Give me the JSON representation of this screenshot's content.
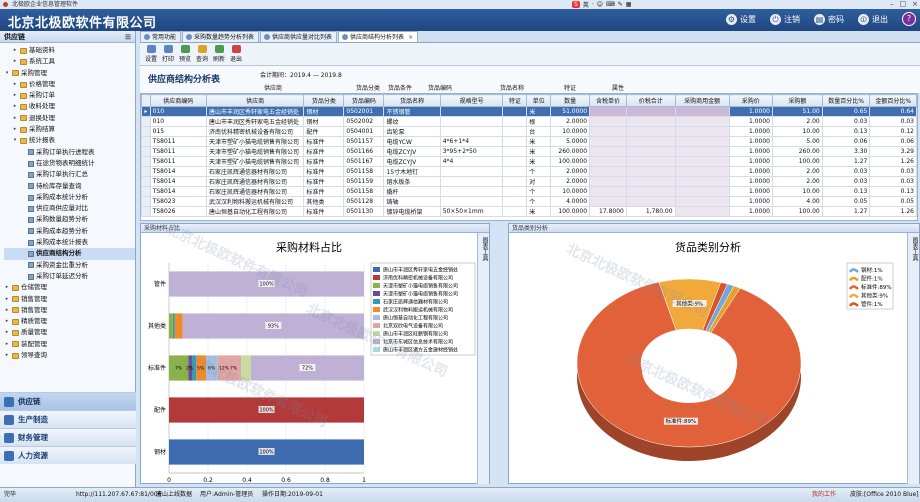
{
  "window": {
    "title": "北极欧企业信息管理软件"
  },
  "ime": {
    "items": [
      "S",
      "英",
      "·",
      "☺",
      "⌨",
      "✎",
      "▦"
    ]
  },
  "header": {
    "company": "北京北极欧软件有限公司",
    "buttons": [
      {
        "label": "设置",
        "icon": "gear-icon"
      },
      {
        "label": "注销",
        "icon": "logout-icon"
      },
      {
        "label": "密码",
        "icon": "key-icon"
      },
      {
        "label": "退出",
        "icon": "power-icon"
      }
    ],
    "help_icon": "?"
  },
  "sidebar": {
    "title": "供应链",
    "pin": "⊞",
    "tree": [
      {
        "label": "基础资料",
        "level": 2,
        "type": "folder",
        "exp": "▸"
      },
      {
        "label": "系统工具",
        "level": 2,
        "type": "folder",
        "exp": "▸"
      },
      {
        "label": "采购管理",
        "level": 1,
        "type": "folder",
        "exp": "▾"
      },
      {
        "label": "价格管理",
        "level": 2,
        "type": "folder",
        "exp": "▸"
      },
      {
        "label": "采购订单",
        "level": 2,
        "type": "folder",
        "exp": "▸"
      },
      {
        "label": "收料处理",
        "level": 2,
        "type": "folder",
        "exp": "▸"
      },
      {
        "label": "退换处理",
        "level": 2,
        "type": "folder",
        "exp": "▸"
      },
      {
        "label": "采购结算",
        "level": 2,
        "type": "folder",
        "exp": "▸"
      },
      {
        "label": "统计报表",
        "level": 2,
        "type": "folder",
        "exp": "▾"
      },
      {
        "label": "采购订单执行进程表",
        "level": 3,
        "type": "leaf"
      },
      {
        "label": "在途货物表明细统计",
        "level": 3,
        "type": "leaf"
      },
      {
        "label": "采购订单执行汇总",
        "level": 3,
        "type": "leaf"
      },
      {
        "label": "待检库存量查询",
        "level": 3,
        "type": "leaf"
      },
      {
        "label": "采购成本统计分析",
        "level": 3,
        "type": "leaf"
      },
      {
        "label": "供应商供应量对比",
        "level": 3,
        "type": "leaf"
      },
      {
        "label": "采购数量趋势分析",
        "level": 3,
        "type": "leaf"
      },
      {
        "label": "采购成本趋势分析",
        "level": 3,
        "type": "leaf"
      },
      {
        "label": "采购成本统计报表",
        "level": 3,
        "type": "leaf"
      },
      {
        "label": "供应商结构分析",
        "level": 3,
        "type": "leaf",
        "selected": true
      },
      {
        "label": "采购资金比重分析",
        "level": 3,
        "type": "leaf"
      },
      {
        "label": "采购订单延迟分析",
        "level": 3,
        "type": "leaf"
      },
      {
        "label": "仓储管理",
        "level": 1,
        "type": "folder",
        "exp": "▸"
      },
      {
        "label": "销售管理",
        "level": 1,
        "type": "folder",
        "exp": "▸"
      },
      {
        "label": "销售管理",
        "level": 1,
        "type": "folder",
        "exp": "▸"
      },
      {
        "label": "精质管理",
        "level": 1,
        "type": "folder",
        "exp": "▸"
      },
      {
        "label": "质量管理",
        "level": 1,
        "type": "folder",
        "exp": "▸"
      },
      {
        "label": "装配管理",
        "level": 1,
        "type": "folder",
        "exp": "▸"
      },
      {
        "label": "领导查询",
        "level": 1,
        "type": "folder",
        "exp": "▸"
      }
    ],
    "modules": [
      "供应链",
      "生产制造",
      "财务管理",
      "人力资源"
    ]
  },
  "tabs": [
    {
      "label": "常用功能"
    },
    {
      "label": "采购数量趋势分析列表"
    },
    {
      "label": "供应商供应量对比列表"
    },
    {
      "label": "供应商结构分析列表",
      "active": true,
      "close": "×"
    }
  ],
  "toolbar": [
    "设置",
    "打印",
    "预览",
    "查询",
    "刷新",
    "退出"
  ],
  "report": {
    "title": "供应商结构分析表",
    "period_label": "会计期间：2019.4 — 2019.8",
    "filter_labels": [
      "供应商",
      "货品分类",
      "货品条件",
      "货品编码",
      "货品名称",
      "特证",
      "属性"
    ]
  },
  "grid": {
    "columns": [
      "供应商编码",
      "供应商",
      "货品分类",
      "货品编码",
      "货品名称",
      "规格型号",
      "特证",
      "单位",
      "数量",
      "含税单价",
      "价税合计",
      "采购商用金额",
      "采购价",
      "采购额",
      "数量百分比%",
      "金额百分比%"
    ],
    "rows": [
      [
        "010",
        "唐山市丰润区秀轩家电五金经销处",
        "钢材",
        "0502001",
        "不锈钢管",
        "",
        "",
        "米",
        "51.0000",
        "",
        "",
        "",
        "1.0000",
        "51.00",
        "0.65",
        "0.64"
      ],
      [
        "010",
        "唐山市丰润区秀轩家电五金经销处",
        "钢材",
        "0502002",
        "螺纹",
        "",
        "",
        "根",
        "2.0000",
        "",
        "",
        "",
        "1.0000",
        "2.00",
        "0.03",
        "0.03"
      ],
      [
        "015",
        "济南优科精密机械设备有限公司",
        "配件",
        "0504001",
        "齿轮泵",
        "",
        "",
        "台",
        "10.0000",
        "",
        "",
        "",
        "1.0000",
        "10.00",
        "0.13",
        "0.12"
      ],
      [
        "TS8011",
        "天津市塑矿小猫电缆销售有限公司",
        "标准件",
        "0501157",
        "电缆YCW",
        "4*6+1*4",
        "",
        "米",
        "5.0000",
        "",
        "",
        "",
        "1.0000",
        "5.00",
        "0.06",
        "0.06"
      ],
      [
        "TS8011",
        "天津市塑矿小猫电缆销售有限公司",
        "标准件",
        "0501166",
        "电缆ZCYJV",
        "3*95+2*50",
        "",
        "米",
        "260.0000",
        "",
        "",
        "",
        "1.0000",
        "260.00",
        "3.30",
        "3.29"
      ],
      [
        "TS8011",
        "天津市塑矿小猫电缆销售有限公司",
        "标准件",
        "0501167",
        "电缆ZCYJV",
        "4*4",
        "",
        "米",
        "100.0000",
        "",
        "",
        "",
        "1.0000",
        "100.00",
        "1.27",
        "1.26"
      ],
      [
        "TS8014",
        "石家庄凯辉通信器材有限公司",
        "标准件",
        "0501158",
        "15寸木地钉",
        "",
        "",
        "个",
        "2.0000",
        "",
        "",
        "",
        "1.0000",
        "2.00",
        "0.03",
        "0.03"
      ],
      [
        "TS8014",
        "石家庄凯辉通信器材有限公司",
        "标准件",
        "0501159",
        "熔水板条",
        "",
        "",
        "对",
        "2.0000",
        "",
        "",
        "",
        "1.0000",
        "2.00",
        "0.03",
        "0.03"
      ],
      [
        "TS8014",
        "石家庄凯辉通信器材有限公司",
        "标准件",
        "0501158",
        "撬杆",
        "",
        "",
        "个",
        "10.0000",
        "",
        "",
        "",
        "1.0000",
        "10.00",
        "0.13",
        "0.13"
      ],
      [
        "TS8023",
        "武汉汉利物料搬运机械有限公司",
        "其他类",
        "0501128",
        "铸轴",
        "",
        "",
        "个",
        "4.0000",
        "",
        "",
        "",
        "1.0000",
        "4.00",
        "0.05",
        "0.05"
      ],
      [
        "TS8026",
        "唐山恒基自动化工程有限公司",
        "标准件",
        "0501130",
        "镀锌电缆桥架",
        "50×50×1mm",
        "",
        "米",
        "100.0000",
        "17.8000",
        "1,780.00",
        "",
        "1.0000",
        "100.00",
        "1.27",
        "1.26"
      ]
    ]
  },
  "left_panel": {
    "header": "采购材料占比",
    "title": "采购材料占比",
    "side_label": "图表工具",
    "xticks": [
      "0",
      "0.2",
      "0.4",
      "0.6",
      "0.8",
      "1"
    ]
  },
  "right_panel": {
    "header": "货品类别分析",
    "title": "货品类别分析",
    "side_label": "图表工具",
    "legend": [
      "钢材:1%",
      "配件:1%",
      "标准件:89%",
      "其他类:9%",
      "管件:1%"
    ]
  },
  "chart_data": [
    {
      "type": "bar",
      "orientation": "horizontal",
      "stacked": "percent",
      "title": "采购材料占比",
      "categories": [
        "钢材",
        "配件",
        "标准件",
        "其他类",
        "管件"
      ],
      "xlim": [
        0,
        1
      ],
      "series": [
        {
          "name": "唐山市丰润区秀轩家电五金经销处",
          "color": "#3d6bb0",
          "values": [
            1.0,
            0,
            0,
            0,
            0
          ],
          "labels": [
            "100%",
            "",
            "",
            "",
            ""
          ]
        },
        {
          "name": "济南优科精密机械设备有限公司",
          "color": "#b23a38",
          "values": [
            0,
            1.0,
            0,
            0,
            0
          ],
          "labels": [
            "",
            "100%",
            "",
            "",
            ""
          ]
        },
        {
          "name": "天津市塑矿小猫电缆销售有限公司",
          "color": "#8bb24a",
          "values": [
            0,
            0,
            0.1,
            0.02,
            0
          ],
          "labels": [
            "",
            "",
            "",
            "",
            ""
          ]
        },
        {
          "name": "天津市塑矿小猫电缆销售有限公司",
          "color": "#6a4a96",
          "values": [
            0,
            0,
            0.02,
            0,
            0
          ],
          "labels": [
            "",
            "",
            "",
            "",
            ""
          ]
        },
        {
          "name": "石家庄凯辉通信器材有限公司",
          "color": "#2f9db5",
          "values": [
            0,
            0,
            0.02,
            0.01,
            0
          ],
          "labels": [
            "",
            "",
            "",
            "",
            ""
          ]
        },
        {
          "name": "武汉汉利物料搬运机械有限公司",
          "color": "#f08b2c",
          "values": [
            0,
            0,
            0.05,
            0.04,
            0
          ],
          "labels": [
            "",
            "",
            "",
            "",
            ""
          ]
        },
        {
          "name": "唐山恒基自动化工程有限公司",
          "color": "#a6bddf",
          "values": [
            0,
            0,
            0.06,
            0,
            0
          ],
          "labels": [
            "",
            "",
            "",
            "",
            ""
          ]
        },
        {
          "name": "北京双欣电气设备有限公司",
          "color": "#e1a6a4",
          "values": [
            0,
            0,
            0.12,
            0,
            0
          ],
          "labels": [
            "",
            "",
            "",
            "",
            ""
          ]
        },
        {
          "name": "唐山市丰润区旺鹏钢有限公司",
          "color": "#c8dca0",
          "values": [
            0,
            0,
            0.05,
            0,
            0
          ],
          "labels": [
            "",
            "",
            "",
            "",
            ""
          ]
        },
        {
          "name": "北京市东城区信息技术有限公司",
          "color": "#bfb0d6",
          "values": [
            0,
            0,
            0.58,
            0.93,
            1.0
          ],
          "labels": [
            "",
            "",
            "72%",
            "93%",
            "100%"
          ]
        },
        {
          "name": "唐山市丰润区诸方五金建材经销处",
          "color": "#aad7e6",
          "values": [
            0,
            0,
            0,
            0,
            0
          ],
          "labels": [
            "",
            "",
            "",
            "",
            ""
          ]
        }
      ],
      "small_labels": [
        "7%",
        "2%",
        "5%",
        "6%",
        "12%",
        "7%"
      ]
    },
    {
      "type": "pie",
      "variant": "doughnut-3d",
      "title": "货品类别分析",
      "slices": [
        {
          "name": "钢材",
          "value": 1,
          "label": "钢材:1%",
          "color": "#6fa8dc"
        },
        {
          "name": "配件",
          "value": 1,
          "label": "配件:1%",
          "color": "#e8a02a"
        },
        {
          "name": "标准件",
          "value": 89,
          "label": "标准件:89%",
          "color": "#e0613a"
        },
        {
          "name": "其他类",
          "value": 9,
          "label": "其他类:9%",
          "color": "#f2a93b"
        },
        {
          "name": "管件",
          "value": 1,
          "label": "管件:1%",
          "color": "#d9542b"
        }
      ]
    }
  ],
  "watermark": "北京北极欧软件有限公司",
  "status": {
    "left": "完毕",
    "url": "http://111.207.67.67:81/006",
    "dept": "唐山上线数据",
    "user": "用户:Admin-管理员",
    "date": "操作日期:2019-09-01",
    "link": "我的工作",
    "skin": "皮肤:[Office 2010 Blue]"
  }
}
